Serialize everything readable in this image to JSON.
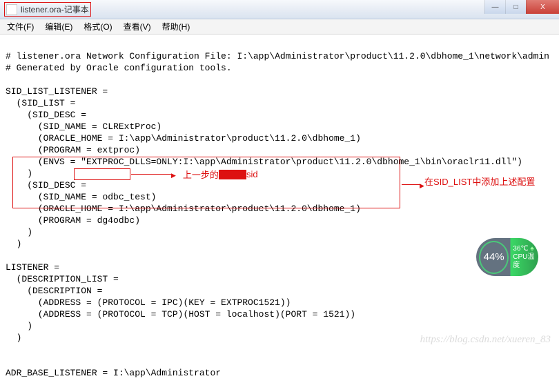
{
  "window": {
    "title_file": "listener.ora",
    "title_app": "记事本"
  },
  "controls": {
    "minimize": "—",
    "maximize": "□",
    "close": "X"
  },
  "menu": {
    "file": "文件(F)",
    "edit": "编辑(E)",
    "format": "格式(O)",
    "view": "查看(V)",
    "help": "帮助(H)"
  },
  "lines": {
    "l1": "# listener.ora Network Configuration File: I:\\app\\Administrator\\product\\11.2.0\\dbhome_1\\network\\admin",
    "l2": "# Generated by Oracle configuration tools.",
    "l3": "",
    "l4": "SID_LIST_LISTENER =",
    "l5": "  (SID_LIST =",
    "l6": "    (SID_DESC =",
    "l7": "      (SID_NAME = CLRExtProc)",
    "l8": "      (ORACLE_HOME = I:\\app\\Administrator\\product\\11.2.0\\dbhome_1)",
    "l9": "      (PROGRAM = extproc)",
    "l10": "      (ENVS = \"EXTPROC_DLLS=ONLY:I:\\app\\Administrator\\product\\11.2.0\\dbhome_1\\bin\\oraclr11.dll\")",
    "l11": "    )",
    "l12": "    (SID_DESC =",
    "l13a": "      (SID_NAME = ",
    "l13b": "odbc_test",
    "l13c": ")",
    "l14": "      (ORACLE_HOME = I:\\app\\Administrator\\product\\11.2.0\\dbhome_1)",
    "l15": "      (PROGRAM = dg4odbc)",
    "l16": "    )",
    "l17": "  )",
    "l18": "",
    "l19": "LISTENER =",
    "l20": "  (DESCRIPTION_LIST =",
    "l21": "    (DESCRIPTION =",
    "l22": "      (ADDRESS = (PROTOCOL = IPC)(KEY = EXTPROC1521))",
    "l23": "      (ADDRESS = (PROTOCOL = TCP)(HOST = localhost)(PORT = 1521))",
    "l24": "    )",
    "l25": "  )",
    "l26": "",
    "l27": "",
    "l28": "ADR_BASE_LISTENER = I:\\app\\Administrator"
  },
  "annotations": {
    "top_pre": "上一步的",
    "top_post": "sid",
    "right": "在SID_LIST中添加上述配置"
  },
  "gauge": {
    "percent": "44%",
    "temp": "36℃",
    "label": "CPU温度"
  },
  "watermark": "https://blog.csdn.net/xueren_83"
}
